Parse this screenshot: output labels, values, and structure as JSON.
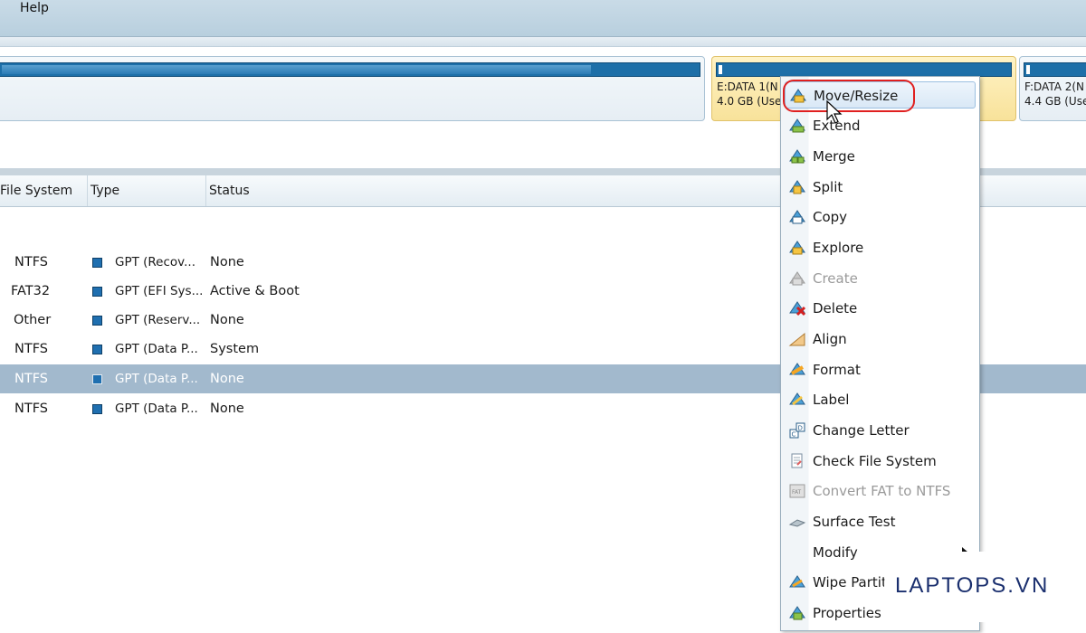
{
  "menubar": {
    "help_label": "Help"
  },
  "disk_map": {
    "partitions": [
      {
        "line1": "",
        "line2": "",
        "used_fraction": 0.85
      },
      {
        "line1": "E:DATA 1(N",
        "line2": "4.0 GB (Use",
        "used_fraction": 0.02,
        "selected": true
      },
      {
        "line1": "F:DATA 2(N",
        "line2": "4.4 GB (Use",
        "used_fraction": 0.02
      }
    ]
  },
  "table": {
    "headers": {
      "file_system": "File System",
      "type": "Type",
      "status": "Status"
    },
    "rows": [
      {
        "file_system": "NTFS",
        "type": "GPT (Recov...",
        "status": "None"
      },
      {
        "file_system": "FAT32",
        "type": "GPT (EFI Sys...",
        "status": "Active & Boot"
      },
      {
        "file_system": "Other",
        "type": "GPT (Reserv...",
        "status": "None"
      },
      {
        "file_system": "NTFS",
        "type": "GPT (Data P...",
        "status": "System"
      },
      {
        "file_system": "NTFS",
        "type": "GPT (Data P...",
        "status": "None",
        "selected": true
      },
      {
        "file_system": "NTFS",
        "type": "GPT (Data P...",
        "status": "None"
      }
    ]
  },
  "context_menu": {
    "items": [
      {
        "label": "Move/Resize",
        "icon": "move-resize-icon",
        "highlighted": true
      },
      {
        "label": "Extend",
        "icon": "extend-icon"
      },
      {
        "label": "Merge",
        "icon": "merge-icon"
      },
      {
        "label": "Split",
        "icon": "split-icon"
      },
      {
        "label": "Copy",
        "icon": "copy-icon"
      },
      {
        "label": "Explore",
        "icon": "explore-icon"
      },
      {
        "label": "Create",
        "icon": "create-icon",
        "disabled": true
      },
      {
        "label": "Delete",
        "icon": "delete-icon"
      },
      {
        "label": "Align",
        "icon": "align-icon"
      },
      {
        "label": "Format",
        "icon": "format-icon"
      },
      {
        "label": "Label",
        "icon": "label-icon"
      },
      {
        "label": "Change Letter",
        "icon": "change-letter-icon"
      },
      {
        "label": "Check File System",
        "icon": "check-file-system-icon"
      },
      {
        "label": "Convert FAT to NTFS",
        "icon": "convert-fat-icon",
        "disabled": true
      },
      {
        "label": "Surface Test",
        "icon": "surface-test-icon"
      },
      {
        "label": "Modify",
        "icon": "",
        "submenu": true
      },
      {
        "label": "Wipe Partiti",
        "icon": "wipe-partition-icon"
      },
      {
        "label": "Properties",
        "icon": "properties-icon"
      }
    ]
  },
  "watermark": {
    "text": "LAPTOPS.VN"
  },
  "colors": {
    "selection_row": "#a2b9cd",
    "partition_bar": "#1d6fa8",
    "highlight_ring": "#e02020"
  }
}
